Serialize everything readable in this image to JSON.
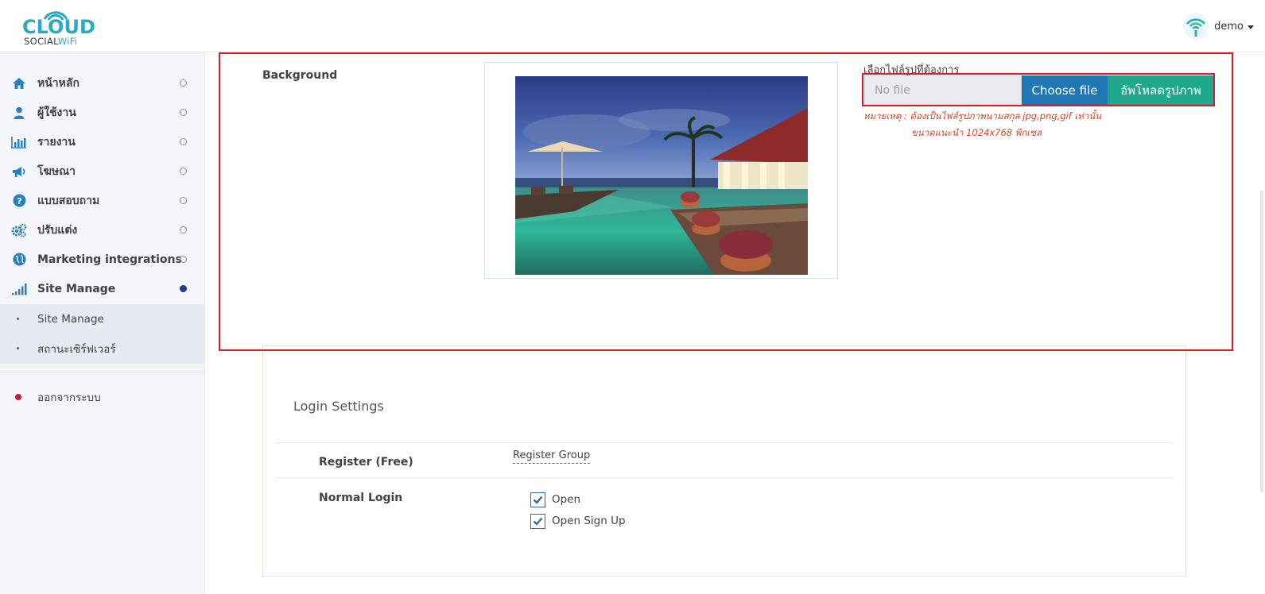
{
  "brand": {
    "logo_main": "CLOUD",
    "logo_sub_a": "SOCIAL",
    "logo_sub_b": "WiFi",
    "accent_color": "#2aa9c7"
  },
  "header": {
    "user_name": "demo",
    "user_icon": "wifi-icon",
    "caret_icon": "caret-down-icon"
  },
  "sidebar": {
    "items": [
      {
        "label": "หน้าหลัก",
        "icon": "home-icon"
      },
      {
        "label": "ผู้ใช้งาน",
        "icon": "user-icon"
      },
      {
        "label": "รายงาน",
        "icon": "bar-chart-icon"
      },
      {
        "label": "โฆษณา",
        "icon": "megaphone-icon"
      },
      {
        "label": "แบบสอบถาม",
        "icon": "question-icon"
      },
      {
        "label": "ปรับแต่ง",
        "icon": "gears-icon"
      },
      {
        "label": "Marketing integrations",
        "icon": "globe-icon"
      },
      {
        "label": "Site Manage",
        "icon": "signal-icon",
        "active": true
      }
    ],
    "sub_items": [
      {
        "label": "Site Manage"
      },
      {
        "label": "สถานะเซิร์ฟเวอร์"
      }
    ],
    "logout_label": "ออกจากระบบ"
  },
  "background_section": {
    "label": "Background",
    "upload_label": "เลือกไฟล์รูปที่ต้องการ",
    "file_value": "No file",
    "choose_button": "Choose file",
    "upload_button": "อัพโหลดรูปภาพ",
    "note_line1": "หมายเหตุ : ต้องเป็นไฟล์รูปภาพนามสกุล jpg,png,gif เท่านั้น",
    "note_line2": "ขนาดแนะนำ 1024x768 พิกเซล"
  },
  "login_settings": {
    "title": "Login Settings",
    "register_label": "Register (Free)",
    "register_value": "Register Group",
    "normal_login_label": "Normal Login",
    "options": [
      {
        "label": "Open",
        "checked": true
      },
      {
        "label": "Open Sign Up",
        "checked": true
      }
    ]
  },
  "colors": {
    "highlight": "#d41f26",
    "choose_button": "#1f78b4",
    "upload_button": "#20a88c",
    "note_text": "#d4452b",
    "active_dot": "#1d3b8a",
    "logout_dot": "#c3213a"
  }
}
